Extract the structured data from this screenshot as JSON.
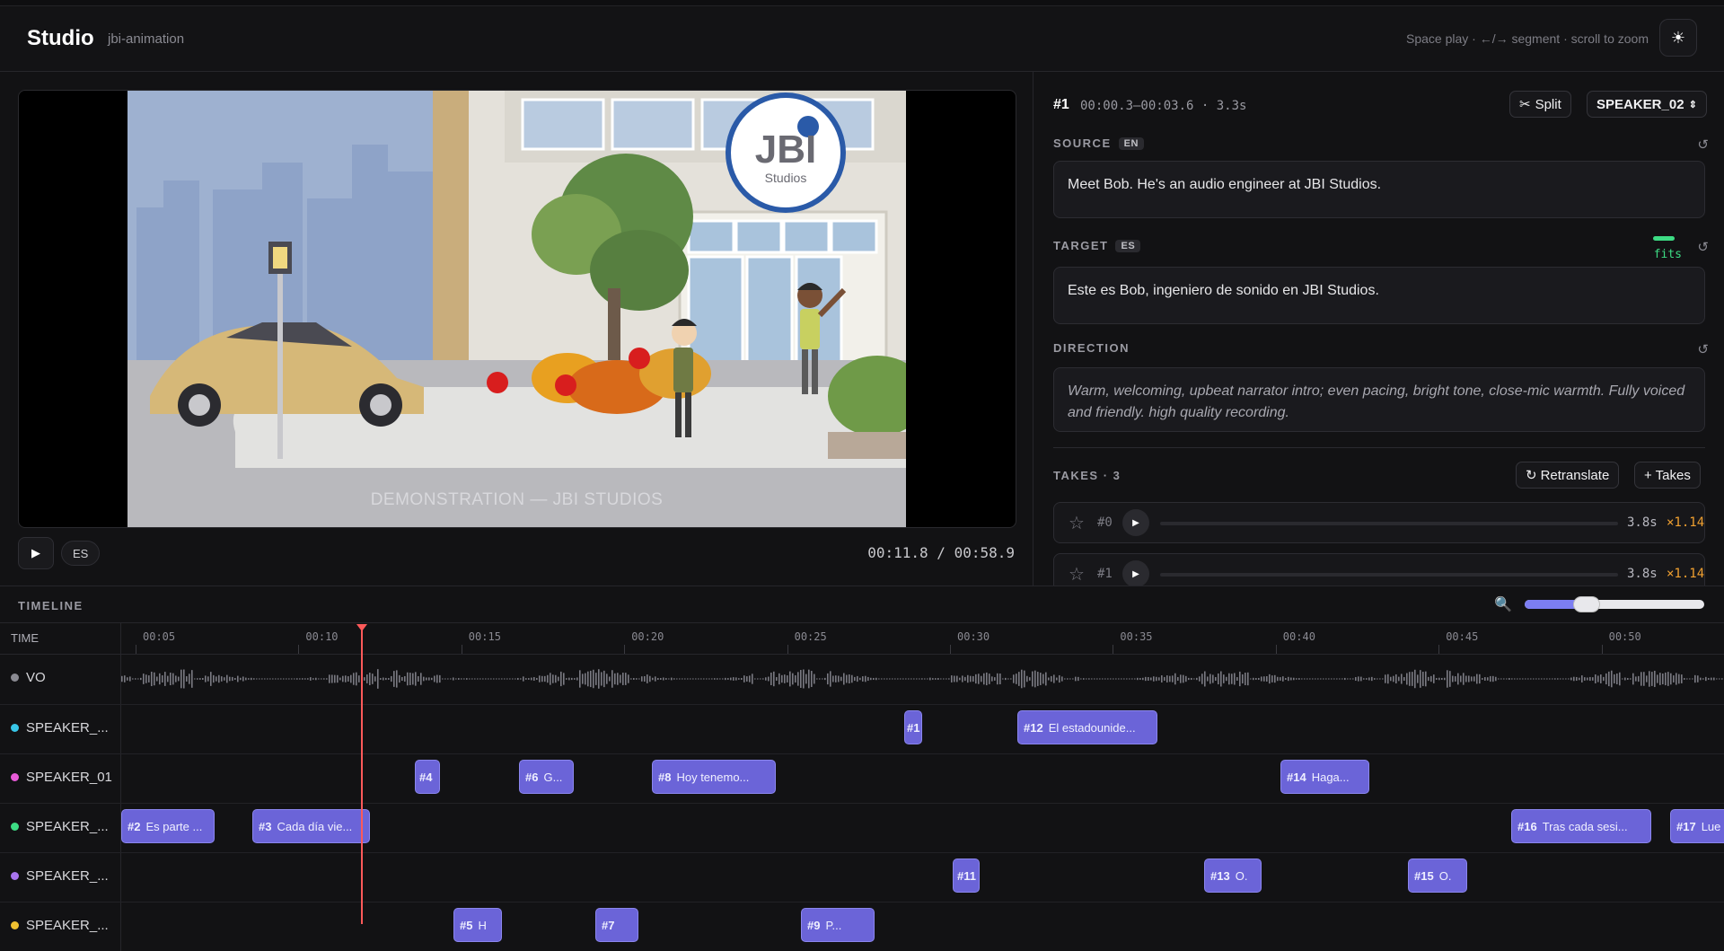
{
  "header": {
    "brand": "Studio",
    "project": "jbi-animation",
    "hint": "Space play · ←/→ segment · scroll to zoom",
    "theme_icon": "sun-icon"
  },
  "player": {
    "watermark": "DEMONSTRATION — JBI STUDIOS",
    "logo_main": "JBI",
    "logo_sub": "Studios",
    "play_label": "▶",
    "lang": "ES",
    "timecode": "00:11.8 / 00:58.9"
  },
  "segment": {
    "id": "#1",
    "time": "00:00.3–00:03.6 · 3.3s",
    "split_label": "Split",
    "speaker": "SPEAKER_02",
    "source_label": "SOURCE",
    "source_lang": "EN",
    "source_text": "Meet Bob. He's an audio engineer at JBI Studios.",
    "target_label": "TARGET",
    "target_lang": "ES",
    "target_text": "Este es Bob, ingeniero de sonido en JBI Studios.",
    "fits_label": "fits",
    "direction_label": "DIRECTION",
    "direction_text": "Warm, welcoming, upbeat narrator intro; even pacing, bright tone, close-mic warmth. Fully voiced and friendly. high quality recording.",
    "takes_label": "TAKES · 3",
    "retranslate_label": "Retranslate",
    "add_takes_label": "+ Takes",
    "takes": [
      {
        "id": "#0",
        "duration": "3.8s",
        "ratio": "×1.14"
      },
      {
        "id": "#1",
        "duration": "3.8s",
        "ratio": "×1.14"
      }
    ],
    "fits_color": "#3ddc84"
  },
  "timeline": {
    "title": "TIMELINE",
    "time_header": "TIME",
    "ticks": [
      "00:05",
      "00:10",
      "00:15",
      "00:20",
      "00:25",
      "00:30",
      "00:35",
      "00:40",
      "00:45",
      "00:50"
    ],
    "zoom_level": 0.27,
    "playhead_time": "00:11.8",
    "tracks": [
      {
        "name": "VO",
        "color": "#8a8a92"
      },
      {
        "name": "SPEAKER_...",
        "color": "#38c6e8"
      },
      {
        "name": "SPEAKER_01",
        "color": "#e85bd8"
      },
      {
        "name": "SPEAKER_...",
        "color": "#3ddc84"
      },
      {
        "name": "SPEAKER_...",
        "color": "#a874ee"
      },
      {
        "name": "SPEAKER_...",
        "color": "#f0c030"
      }
    ],
    "segments": {
      "row1": [
        {
          "id": "#1",
          "text": ""
        },
        {
          "id": "#12",
          "text": "El estadounide..."
        }
      ],
      "row2": [
        {
          "id": "#4",
          "text": ""
        },
        {
          "id": "#6",
          "text": "G..."
        },
        {
          "id": "#8",
          "text": "Hoy tenemo..."
        },
        {
          "id": "#14",
          "text": "Haga..."
        }
      ],
      "row3": [
        {
          "id": "#2",
          "text": "Es parte ..."
        },
        {
          "id": "#3",
          "text": "Cada día vie..."
        },
        {
          "id": "#16",
          "text": "Tras cada sesi..."
        },
        {
          "id": "#17",
          "text": "Lue"
        }
      ],
      "row4": [
        {
          "id": "#11",
          "text": ""
        },
        {
          "id": "#13",
          "text": "O."
        },
        {
          "id": "#15",
          "text": "O."
        }
      ],
      "row5": [
        {
          "id": "#5",
          "text": "H"
        },
        {
          "id": "#7",
          "text": ""
        },
        {
          "id": "#9",
          "text": "P..."
        }
      ]
    },
    "segment_color": "#6b64d8",
    "playhead_color": "#ff5a5a"
  }
}
